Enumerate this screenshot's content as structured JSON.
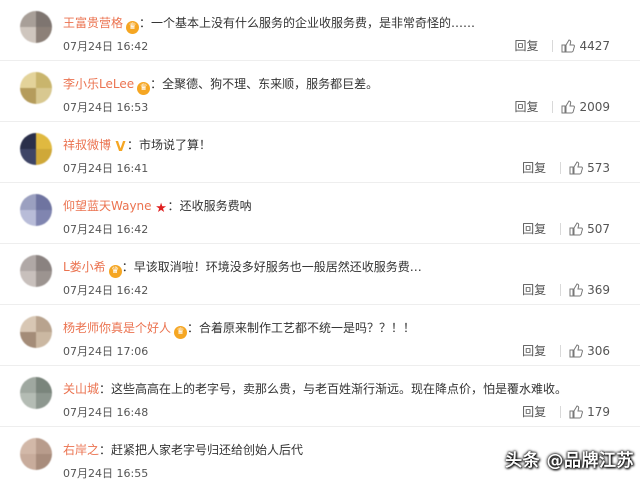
{
  "comments": [
    {
      "user": "王富贵营格",
      "badge": "crown",
      "text": "一个基本上没有什么服务的企业收服务费，是非常奇怪的……",
      "time": "07月24日 16:42",
      "reply": "回复",
      "likes": "4427",
      "avatar_colors": [
        "#a89f98",
        "#7e7570",
        "#cfc6be",
        "#8c8078"
      ]
    },
    {
      "user": "李小乐LeLee",
      "badge": "crown",
      "text": "全聚德、狗不理、东来顺，服务都巨差。",
      "time": "07月24日 16:53",
      "reply": "回复",
      "likes": "2009",
      "avatar_colors": [
        "#e3d39a",
        "#c9b56d",
        "#b59c5c",
        "#d8c890"
      ]
    },
    {
      "user": "祥叔微博",
      "badge": "vip",
      "text": "市场说了算！",
      "time": "07月24日 16:41",
      "reply": "回复",
      "likes": "573",
      "avatar_colors": [
        "#2a2f4a",
        "#e0b940",
        "#3e4566",
        "#cfa838"
      ]
    },
    {
      "user": "仰望蓝天Wayne",
      "badge": "star",
      "text": "还收服务费呐",
      "time": "07月24日 16:42",
      "reply": "回复",
      "likes": "507",
      "avatar_colors": [
        "#9ba0c0",
        "#6f74a0",
        "#b8bcd8",
        "#8085b0"
      ]
    },
    {
      "user": "L娄小希",
      "badge": "crown",
      "text": "早该取消啦！环境没多好服务也一般居然还收服务费…",
      "time": "07月24日 16:42",
      "reply": "回复",
      "likes": "369",
      "avatar_colors": [
        "#b0a8a6",
        "#8a8280",
        "#c8c0bc",
        "#9c9490"
      ]
    },
    {
      "user": "杨老师你真是个好人",
      "badge": "crown",
      "text": "合着原来制作工艺都不统一是吗？？！！",
      "time": "07月24日 17:06",
      "reply": "回复",
      "likes": "306",
      "avatar_colors": [
        "#d8c7b4",
        "#b8a38e",
        "#a48c78",
        "#cbb8a2"
      ]
    },
    {
      "user": "关山城",
      "badge": "",
      "text": "这些高高在上的老字号，卖那么贵，与老百姓渐行渐远。现在降点价，怕是覆水难收。",
      "time": "07月24日 16:48",
      "reply": "回复",
      "likes": "179",
      "avatar_colors": [
        "#9fa8a0",
        "#7a857c",
        "#b4bcb4",
        "#8d978f"
      ]
    },
    {
      "user": "右岸之",
      "badge": "",
      "text": "赶紧把人家老字号归还给创始人后代",
      "time": "07月24日 16:55",
      "reply": "",
      "likes": "",
      "avatar_colors": [
        "#d2b8a8",
        "#b89c8c",
        "#c8ac9c",
        "#a88c7c"
      ]
    }
  ],
  "watermark": "头条 @品牌江苏",
  "colors": {
    "username": "#eb7350",
    "badge": "#f5a623",
    "star": "#e02020"
  }
}
